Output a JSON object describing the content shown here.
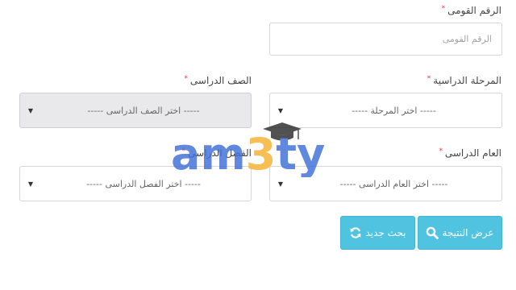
{
  "national_id": {
    "label": "الرقم القومى",
    "required_mark": "*",
    "placeholder": "الرقم القومى"
  },
  "stage": {
    "label": "المرحلة الدراسية",
    "required_mark": "*",
    "value": "----- اختر المرحلة -----"
  },
  "grade": {
    "label": "الصف الدراسى",
    "required_mark": "*",
    "value": "----- اختر الصف الدراسى -----"
  },
  "year": {
    "label": "العام الدراسى",
    "required_mark": "*",
    "value": "----- اختر العام الدراسى -----"
  },
  "term": {
    "label": "الفصل الدراسى",
    "required_mark": "*",
    "value": "----- اختر الفصل الدراسى -----"
  },
  "buttons": {
    "show_result": "عرض النتيجة",
    "new_search": "بحث جديد"
  },
  "watermark": {
    "text": "am3ty",
    "icon": "graduation-cap-icon"
  },
  "colors": {
    "button": "#4fc3e0",
    "required": "#e23b3b",
    "watermark_blue": "#3f6fd8",
    "watermark_orange": "#f5b02e"
  }
}
